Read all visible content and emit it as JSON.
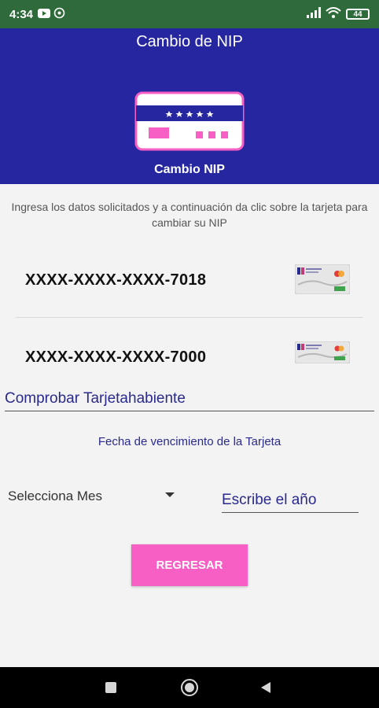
{
  "status_bar": {
    "time": "4:34",
    "battery": "44"
  },
  "header": {
    "title": "Cambio de NIP",
    "subtitle": "Cambio NIP"
  },
  "instructions": "Ingresa los datos solicitados y a continuación da clic sobre la tarjeta para cambiar su NIP",
  "cards": [
    {
      "number": "XXXX-XXXX-XXXX-7018"
    },
    {
      "number": "XXXX-XXXX-XXXX-7000"
    }
  ],
  "verify_label": "Comprobar Tarjetahabiente",
  "expiration_label": "Fecha de vencimiento de la Tarjeta",
  "month_select": {
    "value": "Selecciona Mes"
  },
  "year_input": {
    "placeholder": "Escribe el año"
  },
  "back_button": "REGRESAR",
  "colors": {
    "header_bg": "#2627a0",
    "status_bg": "#2f6b3a",
    "accent_pink": "#f85fc4",
    "text_blue": "#2a2a8c"
  }
}
